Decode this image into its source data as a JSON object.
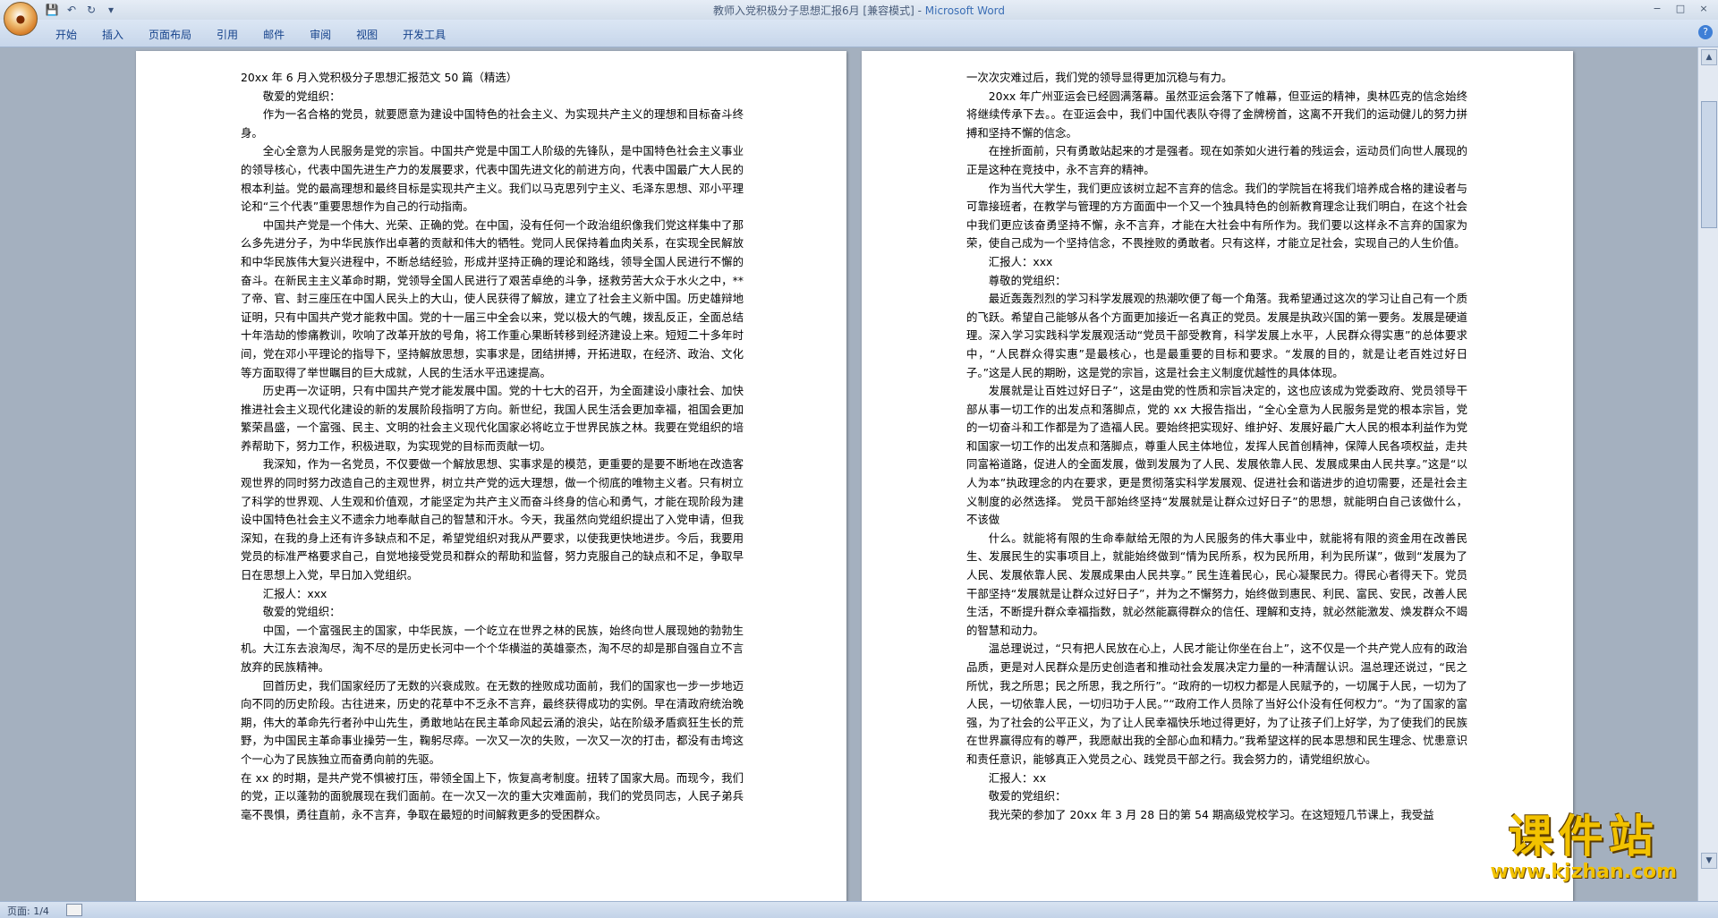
{
  "window": {
    "title": "教师入党积极分子思想汇报6月 [兼容模式] - ",
    "app_name": "Microsoft Word",
    "office_button_icon": "office-logo-icon",
    "controls": [
      "−",
      "□",
      "×"
    ]
  },
  "quick_access": {
    "save_icon": "save-icon",
    "undo_icon": "undo-icon",
    "redo_icon": "redo-icon",
    "customize_icon": "dropdown-arrow-icon"
  },
  "ribbon": {
    "tabs": [
      "开始",
      "插入",
      "页面布局",
      "引用",
      "邮件",
      "审阅",
      "视图",
      "开发工具"
    ],
    "help_label": "?"
  },
  "page1": {
    "paragraphs": [
      "20xx 年 6 月入党积极分子思想汇报范文 50 篇（精选）",
      "敬爱的党组织：",
      "作为一名合格的党员，就要愿意为建设中国特色的社会主义、为实现共产主义的理想和目标奋斗终身。",
      "全心全意为人民服务是党的宗旨。中国共产党是中国工人阶级的先锋队，是中国特色社会主义事业的领导核心，代表中国先进生产力的发展要求，代表中国先进文化的前进方向，代表中国最广大人民的根本利益。党的最高理想和最终目标是实现共产主义。我们以马克思列宁主义、毛泽东思想、邓小平理论和“三个代表”重要思想作为自己的行动指南。",
      "中国共产党是一个伟大、光荣、正确的党。在中国，没有任何一个政治组织像我们党这样集中了那么多先进分子，为中华民族作出卓著的贡献和伟大的牺牲。党同人民保持着血肉关系，在实现全民解放和中华民族伟大复兴进程中，不断总结经验，形成并坚持正确的理论和路线，领导全国人民进行不懈的奋斗。在新民主主义革命时期，党领导全国人民进行了艰苦卓绝的斗争，拯救劳苦大众于水火之中，**了帝、官、封三座压在中国人民头上的大山，使人民获得了解放，建立了社会主义新中国。历史雄辩地证明，只有中国共产党才能救中国。党的十一届三中全会以来，党以极大的气魄，拨乱反正，全面总结十年浩劫的惨痛教训，吹响了改革开放的号角，将工作重心果断转移到经济建设上来。短短二十多年时间，党在邓小平理论的指导下，坚持解放思想，实事求是，团结拼搏，开拓进取，在经济、政治、文化等方面取得了举世瞩目的巨大成就，人民的生活水平迅速提高。",
      "历史再一次证明，只有中国共产党才能发展中国。党的十七大的召开，为全面建设小康社会、加快推进社会主义现代化建设的新的发展阶段指明了方向。新世纪，我国人民生活会更加幸福，祖国会更加繁荣昌盛，一个富强、民主、文明的社会主义现代化国家必将屹立于世界民族之林。我要在党组织的培养帮助下，努力工作，积极进取，为实现党的目标而贡献一切。",
      "我深知，作为一名党员，不仅要做一个解放思想、实事求是的模范，更重要的是要不断地在改造客观世界的同时努力改造自己的主观世界，树立共产党的远大理想，做一个彻底的唯物主义者。只有树立了科学的世界观、人生观和价值观，才能坚定为共产主义而奋斗终身的信心和勇气，才能在现阶段为建设中国特色社会主义不遗余力地奉献自己的智慧和汗水。今天，我虽然向党组织提出了入党申请，但我深知，在我的身上还有许多缺点和不足，希望党组织对我从严要求，以使我更快地进步。今后，我要用党员的标准严格要求自己，自觉地接受党员和群众的帮助和监督，努力克服自己的缺点和不足，争取早日在思想上入党，早日加入党组织。",
      "汇报人：xxx",
      "敬爱的党组织：",
      "中国，一个富强民主的国家，中华民族，一个屹立在世界之林的民族，始终向世人展现她的勃勃生机。大江东去浪淘尽，淘不尽的是历史长河中一个个华横溢的英雄豪杰，淘不尽的却是那自强自立不言放弃的民族精神。",
      "回首历史，我们国家经历了无数的兴衰成败。在无数的挫败成功面前，我们的国家也一步一步地迈向不同的历史阶段。古往进来，历史的花草中不乏永不言弃，最终获得成功的实例。早在清政府统治晚期，伟大的革命先行者孙中山先生，勇敢地站在民主革命风起云涌的浪尖，站在阶级矛盾疯狂生长的荒野，为中国民主革命事业操劳一生，鞠躬尽瘁。一次又一次的失败，一次又一次的打击，都没有击垮这个一心为了民族独立而奋勇向前的先驱。",
      "在 xx 的时期，是共产党不惧被打压，带领全国上下，恢复高考制度。扭转了国家大局。而现今，我们的党，正以蓬勃的面貌展现在我们面前。在一次又一次的重大灾难面前，我们的党员同志，人民子弟兵毫不畏惧，勇往直前，永不言弃，争取在最短的时间解救更多的受困群众。"
    ]
  },
  "page2": {
    "paragraphs": [
      "一次次灾难过后，我们党的领导显得更加沉稳与有力。",
      "20xx 年广州亚运会已经圆满落幕。虽然亚运会落下了帷幕，但亚运的精神，奥林匹克的信念始终将继续传承下去。。在亚运会中，我们中国代表队夺得了金牌榜首，这离不开我们的运动健儿的努力拼搏和坚持不懈的信念。",
      "在挫折面前，只有勇敢站起来的才是强者。现在如荼如火进行着的残运会，运动员们向世人展现的正是这种在竞技中，永不言弃的精神。",
      "作为当代大学生，我们更应该树立起不言弃的信念。我们的学院旨在将我们培养成合格的建设者与可靠接班者，在教学与管理的方方面面中一个又一个独具特色的创新教育理念让我们明白，在这个社会中我们更应该奋勇坚持不懈，永不言弃，才能在大社会中有所作为。我们要以这样永不言弃的国家为荣，使自己成为一个坚持信念，不畏挫败的勇敢者。只有这样，才能立足社会，实现自己的人生价值。",
      "汇报人：xxx",
      "尊敬的党组织：",
      "最近轰轰烈烈的学习科学发展观的热潮吹便了每一个角落。我希望通过这次的学习让自己有一个质的飞跃。希望自己能够从各个方面更加接近一名真正的党员。发展是执政兴国的第一要务。发展是硬道理。深入学习实践科学发展观活动“党员干部受教育，科学发展上水平，人民群众得实惠”的总体要求中，“人民群众得实惠”是最核心，也是最重要的目标和要求。“发展的目的，就是让老百姓过好日子。”这是人民的期盼，这是党的宗旨，这是社会主义制度优越性的具体体现。",
      "发展就是让百姓过好日子”，这是由党的性质和宗旨决定的，这也应该成为党委政府、党员领导干部从事一切工作的出发点和落脚点，党的 xx 大报告指出，“全心全意为人民服务是党的根本宗旨，党的一切奋斗和工作都是为了造福人民。要始终把实现好、维护好、发展好最广大人民的根本利益作为党和国家一切工作的出发点和落脚点，尊重人民主体地位，发挥人民首创精神，保障人民各项权益，走共同富裕道路，促进人的全面发展，做到发展为了人民、发展依靠人民、发展成果由人民共享。”这是“以人为本”执政理念的内在要求，更是贯彻落实科学发展观、促进社会和谐进步的迫切需要，还是社会主义制度的必然选择。 党员干部始终坚持“发展就是让群众过好日子”的思想，就能明白自己该做什么，不该做",
      "什么。就能将有限的生命奉献给无限的为人民服务的伟大事业中，就能将有限的资金用在改善民生、发展民生的实事项目上，就能始终做到“情为民所系，权为民所用，利为民所谋”，做到“发展为了人民、发展依靠人民、发展成果由人民共享。” 民生连着民心，民心凝聚民力。得民心者得天下。党员干部坚持“发展就是让群众过好日子”，并为之不懈努力，始终做到惠民、利民、富民、安民，改善人民生活，不断提升群众幸福指数，就必然能赢得群众的信任、理解和支持，就必然能激发、焕发群众不竭的智慧和动力。",
      "温总理说过，“只有把人民放在心上，人民才能让你坐在台上”，这不仅是一个共产党人应有的政治品质，更是对人民群众是历史创造者和推动社会发展决定力量的一种清醒认识。温总理还说过，“民之所忧，我之所思；民之所思，我之所行”。“政府的一切权力都是人民赋予的，一切属于人民，一切为了人民，一切依靠人民，一切归功于人民。”“政府工作人员除了当好公仆没有任何权力”。“为了国家的富强，为了社会的公平正义，为了让人民幸福快乐地过得更好，为了让孩子们上好学，为了使我们的民族在世界赢得应有的尊严，我愿献出我的全部心血和精力。”我希望这样的民本思想和民生理念、忧患意识和责任意识，能够真正入党员之心、践党员干部之行。我会努力的，请党组织放心。",
      "汇报人：xx",
      "敬爱的党组织：",
      "我光荣的参加了 20xx 年 3 月 28 日的第 54 期高级党校学习。在这短短几节课上，我受益"
    ]
  },
  "statusbar": {
    "page_info": "页面: 1/4"
  },
  "watermark": {
    "line1": "课件站",
    "line2": "www.kjzhan.com"
  }
}
